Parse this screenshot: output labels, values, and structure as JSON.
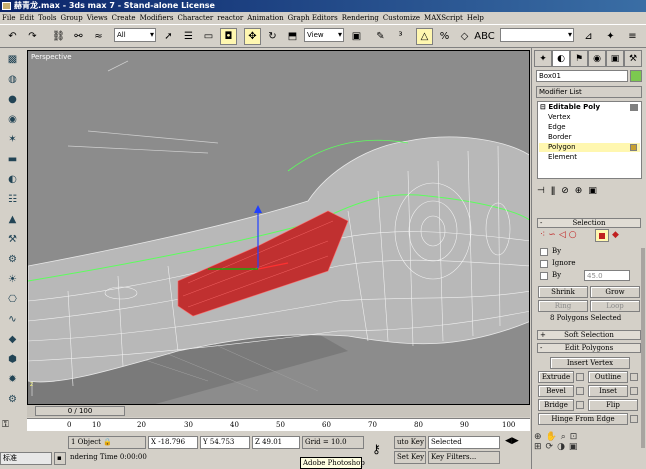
{
  "titlebar": {
    "title": "赫青龙.max - 3ds max 7 - Stand-alone License"
  },
  "menu": [
    "File",
    "Edit",
    "Tools",
    "Group",
    "Views",
    "Create",
    "Modifiers",
    "Character",
    "reactor",
    "Animation",
    "Graph Editors",
    "Rendering",
    "Customize",
    "MAXScript",
    "Help"
  ],
  "toolbar": {
    "selection_filter": "All",
    "ref_coord": "View",
    "named_selection": ""
  },
  "viewport": {
    "label": "Perspective"
  },
  "panel": {
    "object_name": "Box01",
    "modifier_list": "Modifier List",
    "stack": {
      "root": "Editable Poly",
      "items": [
        "Vertex",
        "Edge",
        "Border",
        "Polygon",
        "Element"
      ],
      "selected_index": 3
    },
    "selection": {
      "title": "Selection",
      "by_vertex": "By",
      "ignore_backfacing": "Ignore",
      "by_angle": "By",
      "angle_value": "45.0",
      "shrink": "Shrink",
      "grow": "Grow",
      "ring": "Ring",
      "loop": "Loop",
      "status": "8 Polygons Selected"
    },
    "soft_selection": {
      "title": "Soft Selection"
    },
    "edit_polygons": {
      "title": "Edit Polygons",
      "insert_vertex": "Insert Vertex",
      "extrude": "Extrude",
      "outline": "Outline",
      "bevel": "Bevel",
      "inset": "Inset",
      "bridge": "Bridge",
      "flip": "Flip",
      "hinge": "Hinge From Edge"
    }
  },
  "timeline": {
    "frame": "0 / 100",
    "ticks": [
      "0",
      "10",
      "20",
      "30",
      "40",
      "50",
      "60",
      "70",
      "80",
      "90",
      "100"
    ]
  },
  "status": {
    "selected": "1 Object",
    "x": "-18.796",
    "y": "54.753",
    "z": "49.01",
    "grid": "Grid = 10.0",
    "auto_key": "uto Key",
    "set_key": "Set Key",
    "key_mode": "Selected",
    "key_filters": "Key Filters...",
    "rendering_time": "ndering Time  0:00:00",
    "ime": "标准",
    "tooltip": "Adobe Photoshop"
  },
  "colors": {
    "viewport": "#8c8c8c",
    "selection": "#c03030",
    "panel_highlight": "#fff7b0"
  }
}
